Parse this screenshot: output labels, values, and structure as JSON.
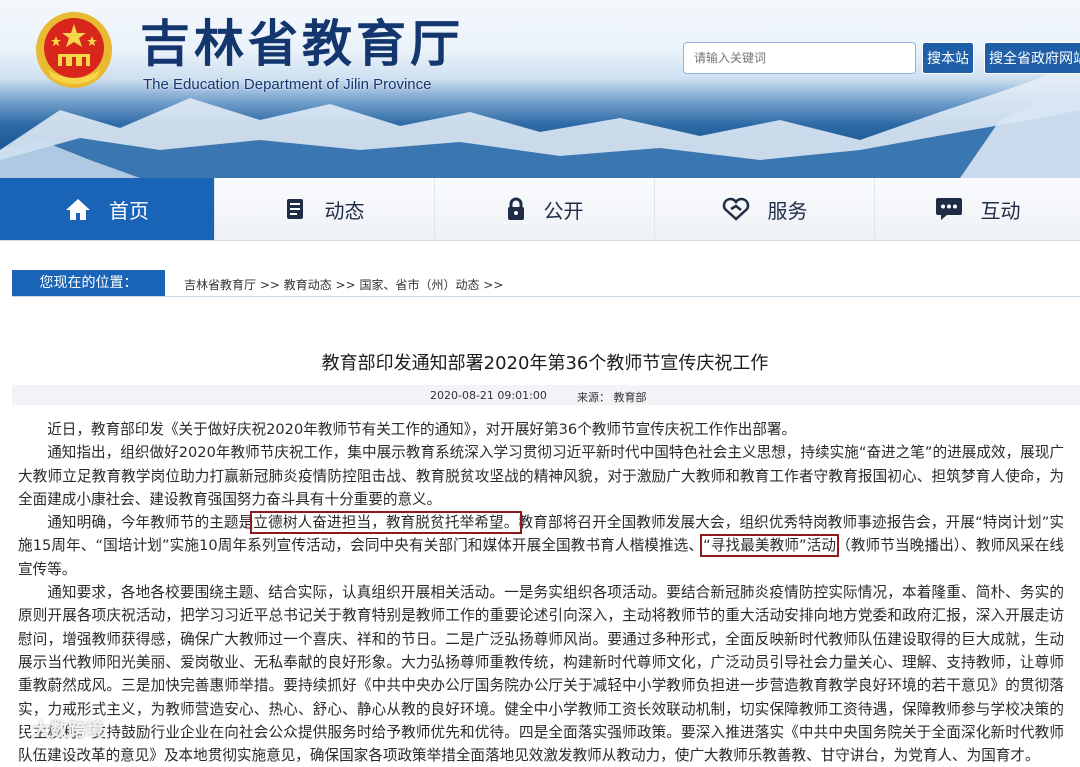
{
  "header": {
    "site_title": "吉林省教育厅",
    "site_subtitle": "The Education Department of Jilin Province",
    "search_placeholder": "请输入关键词",
    "search_site_button": "搜本站",
    "search_gov_button": "搜全省政府网站"
  },
  "nav": {
    "items": [
      {
        "label": "首页",
        "icon": "home-icon",
        "active": true
      },
      {
        "label": "动态",
        "icon": "news-icon",
        "active": false
      },
      {
        "label": "公开",
        "icon": "lock-icon",
        "active": false
      },
      {
        "label": "服务",
        "icon": "handshake-icon",
        "active": false
      },
      {
        "label": "互动",
        "icon": "chat-icon",
        "active": false
      }
    ]
  },
  "breadcrumb": {
    "label": "您现在的位置：",
    "path": "吉林省教育厅 >> 教育动态 >> 国家、省市（州）动态 >>"
  },
  "article": {
    "title": "教育部印发通知部署2020年第36个教师节宣传庆祝工作",
    "date": "2020-08-21 09:01:00",
    "source": "来源：  教育部",
    "p1": "近日，教育部印发《关于做好庆祝2020年教师节有关工作的通知》，对开展好第36个教师节宣传庆祝工作作出部署。",
    "p2": "通知指出，组织做好2020年教师节庆祝工作，集中展示教育系统深入学习贯彻习近平新时代中国特色社会主义思想，持续实施“奋进之笔”的进展成效，展现广大教师立足教育教学岗位助力打赢新冠肺炎疫情防控阻击战、教育脱贫攻坚战的精神风貌，对于激励广大教师和教育工作者守教育报国初心、担筑梦育人使命，为全面建成小康社会、建设教育强国努力奋斗具有十分重要的意义。",
    "p3_a": "通知明确，今年教师节的主题是",
    "p3_theme": "立德树人奋进担当，教育脱贫托举希望。",
    "p3_b": "教育部将召开全国教师发展大会，组织优秀特岗教师事迹报告会，开展“特岗计划”实施15周年、“国培计划”实施10周年系列宣传活动，会同中央有关部门和媒体开展全国教书育人楷模推选、",
    "p3_activity": "“寻找最美教师”活动",
    "p3_c": "（教师节当晚播出）、教师风采在线宣传等。",
    "p4": "通知要求，各地各校要围绕主题、结合实际，认真组织开展相关活动。一是务实组织各项活动。要结合新冠肺炎疫情防控实际情况，本着隆重、简朴、务实的原则开展各项庆祝活动，把学习习近平总书记关于教育特别是教师工作的重要论述引向深入，主动将教师节的重大活动安排向地方党委和政府汇报，深入开展走访慰问，增强教师获得感，确保广大教师过一个喜庆、祥和的节日。二是广泛弘扬尊师风尚。要通过多种形式，全面反映新时代教师队伍建设取得的巨大成就，生动展示当代教师阳光美丽、爱岗敬业、无私奉献的良好形象。大力弘扬尊师重教传统，构建新时代尊师文化，广泛动员引导社会力量关心、理解、支持教师，让尊师重教蔚然成风。三是加快完善惠师举措。要持续抓好《中共中央办公厅国务院办公厅关于减轻中小学教师负担进一步营造教育教学良好环境的若干意见》的贯彻落实，力戒形式主义，为教师营造安心、热心、舒心、静心从教的良好环境。健全中小学教师工资长效联动机制，切实保障教师工资待遇，保障教师参与学校决策的民主权利。支持鼓励行业企业在向社会公众提供服务时给予教师优先和优待。四是全面落实强师政策。要深入推进落实《中共中央国务院关于全面深化新时代教师队伍建设改革的意见》及本地贯彻实施意见，确保国家各项政策举措全面落地见效激发教师从教动力，使广大教师乐教善教、甘守讲台，为党育人、为国育才。"
  },
  "watermark": "大数跨境",
  "colors": {
    "brand_blue": "#1a64b8",
    "title_navy": "#14366e",
    "highlight_box": "#8c1b1b"
  }
}
